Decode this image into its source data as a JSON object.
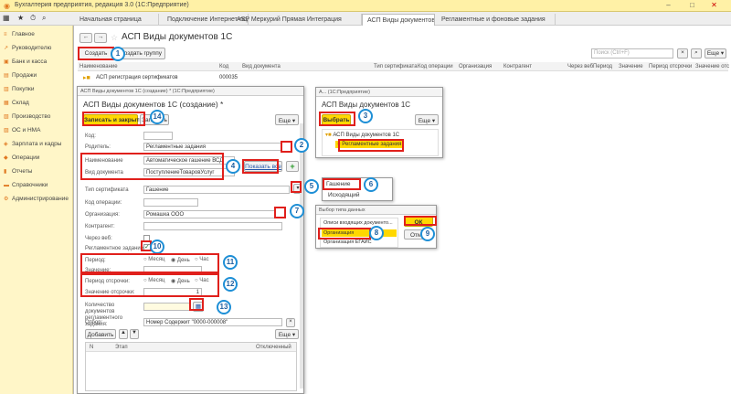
{
  "window": {
    "title": "Бухгалтерия предприятия, редакция 3.0  (1С:Предприятие)"
  },
  "tabs": [
    "Начальная страница",
    "Подключение Интернет-поддержки",
    "ASP Меркурий Прямая Интеграция",
    "АСП Виды документов 1С",
    "Регламентные и фоновые задания"
  ],
  "sidebar": [
    "Главное",
    "Руководителю",
    "Банк и касса",
    "Продажи",
    "Покупки",
    "Склад",
    "Производство",
    "ОС и НМА",
    "Зарплата и кадры",
    "Операции",
    "Отчеты",
    "Справочники",
    "Администрирование"
  ],
  "main": {
    "title": "АСП Виды документов 1С",
    "create": "Создать",
    "create_group": "Создать группу",
    "search_placeholder": "Поиск (Ctrl+F)",
    "more": "Еще",
    "columns": [
      "Наименование",
      "Код",
      "Вид документа",
      "Тип сертификата",
      "Код операции",
      "Организация",
      "Контрагент",
      "Через веб",
      "Период",
      "Значение",
      "Период отсрочки",
      "Значение отс"
    ],
    "row": {
      "name": "АСП регистрация сертификатов",
      "code": "000035"
    }
  },
  "form": {
    "window": "АСП Виды документов 1С (создание) * (1С:Предприятие)",
    "title": "АСП Виды документов 1С (создание) *",
    "save_close": "Записать и закрыть",
    "write": "Записать",
    "more": "Еще",
    "code_label": "Код:",
    "parent_label": "Родитель:",
    "parent_value": "Регламентные задания",
    "name_label": "Наименование",
    "name_value": "Автоматическое гашение ВСД",
    "doctype_label": "Вид документа",
    "doctype_value": "ПоступлениеТоваровУслуг",
    "show_all": "Показать все",
    "cert_label": "Тип сертификата",
    "cert_value": "Гашение",
    "opcode_label": "Код операции:",
    "org_label": "Организация:",
    "org_value": "Ромашка ООО",
    "contr_label": "Контрагент:",
    "web_label": "Через веб:",
    "sched_label": "Регламентное задание:",
    "period_label": "Период:",
    "period_opts": [
      "Месяц",
      "День",
      "Час"
    ],
    "value_label": "Значение:",
    "delay_label": "Период отсрочки:",
    "delay_opts": [
      "Месяц",
      "День",
      "Час"
    ],
    "delay_value_label": "Значение отсрочки:",
    "delay_value": "1",
    "count_label": "Количество документов регламентного задания:",
    "filter_label": "Отбор:",
    "filter_value": "Номер Содержит \"0000-000008\"",
    "add": "Добавить",
    "tbl_n": "N",
    "tbl_step": "Этап",
    "tbl_off": "Отключенный"
  },
  "parent_dialog": {
    "window": "А... (1С:Предприятие)",
    "title": "АСП Виды документов 1С",
    "choose": "Выбрать",
    "more": "Еще",
    "tree": [
      "АСП Виды документов 1С",
      "Регламентные задания"
    ]
  },
  "cert_dropdown": [
    "Гашение",
    "Исходящий"
  ],
  "type_dialog": {
    "window": "Выбор типа данных",
    "items": [
      "Описи входящих документо...",
      "Организация",
      "Организация ЕГАИС"
    ],
    "ok": "ОК",
    "other": "Отм"
  },
  "markers": [
    "1",
    "2",
    "3",
    "4",
    "5",
    "6",
    "7",
    "8",
    "9",
    "10",
    "11",
    "12",
    "13",
    "14"
  ]
}
